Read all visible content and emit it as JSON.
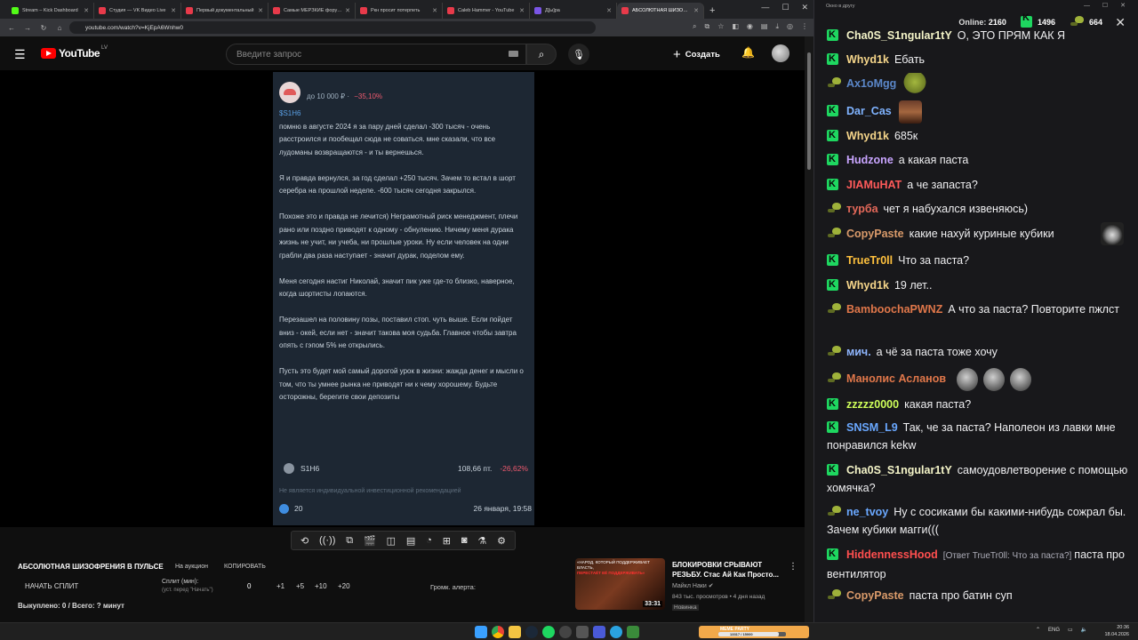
{
  "browser": {
    "tabs": [
      {
        "title": "Stream – Kick Dashboard",
        "color": "#53fc18",
        "active": false
      },
      {
        "title": "Студия — VK Видео Live",
        "color": "#e83a4a",
        "active": false
      },
      {
        "title": "Первый документальный",
        "color": "#e83a4a",
        "active": false
      },
      {
        "title": "Самые МЕРЗКИЕ форумы",
        "color": "#e83a4a",
        "active": false
      },
      {
        "title": "Ркн просит потерпеть",
        "color": "#e83a4a",
        "active": false
      },
      {
        "title": "Caleb Hammer - YouTube",
        "color": "#e83a4a",
        "active": false
      },
      {
        "title": "Д[ы]ра",
        "color": "#7a55e6",
        "active": false
      },
      {
        "title": "АБСОЛЮТНАЯ ШИЗОФРЕНИЯ",
        "color": "#e83a4a",
        "active": true
      }
    ],
    "new_tab": "+",
    "url": "youtube.com/watch?v=KjEpA6Wnhw0"
  },
  "youtube": {
    "logo_text": "YouTube",
    "region": "LV",
    "search_placeholder": "Введите запрос",
    "create_label": "Создать"
  },
  "post": {
    "target": "до 10 000 ₽",
    "change": "−35,10%",
    "author": "$S1H6",
    "paragraphs": [
      "помню в августе 2024 я за пару дней сделал -300 тысяч - очень расстроился и пообещал сюда не соваться. мне сказали, что все лудоманы возвращаются - и ты вернешься.",
      "Я и правда вернулся, за год сделал +250 тысяч. Зачем то встал в шорт серебра на прошлой неделе. -600 тысяч сегодня закрылся.",
      "Похоже это и правда не лечится) Неграмотный риск менеджмент, плечи рано или поздно приводят к одному - обнулению. Ничему меня дурака жизнь не учит, ни учеба, ни прошлые уроки. Ну если человек на одни грабли два раза наступает - значит дурак, поделом ему.",
      "Меня сегодня настиг Николай, значит пик уже где-то близко, наверное, когда шортисты лопаются.",
      "Перезашел на половину позы, поставил стоп. чуть выше. Если пойдет вниз - окей, если нет - значит такова моя судьба. Главное чтобы завтра опять с гэпом 5% не открылись.",
      "Пусть это будет мой самый дорогой урок в жизни: жажда денег и мысли о том, что ты умнее рынка не приводят ни к чему хорошему. Будьте осторожны, берегите свои депозиты"
    ],
    "ticker": "S1H6",
    "price": "108,66 пт.",
    "price_change": "-26,62%",
    "disclaimer": "Не является индивидуальной инвестиционной рекомендацией",
    "likes": "20",
    "date": "26 января, 19:58"
  },
  "panel": {
    "title": "АБСОЛЮТНАЯ ШИЗОФРЕНИЯ В ПУЛЬСЕ",
    "auction": "На аукцион",
    "copy": "КОПИРОВАТЬ",
    "start_split": "НАЧАТЬ СПЛИТ",
    "split_min": "Сплит (мин):",
    "split_hint": "(уст. перед \"Начать\")",
    "split_value": "0",
    "inc": [
      "+1",
      "+5",
      "+10",
      "+20"
    ],
    "alert_label": "Громк. алерта:",
    "bought": "Выкуплено: 0 / Всего: ? минут"
  },
  "recommended": {
    "thumb_text_1": "«НАРОД, КОТОРЫЙ ПОДДЕРЖИВАЕТ ВЛАСТЬ,",
    "thumb_text_2": "ПЕРЕСТАЁТ ЕЁ ПОДДЕРЖИВАТЬ»",
    "duration": "33:31",
    "title": "БЛОКИРОВКИ СРЫВАЮТ РЕЗЬБУ. Стас Ай Как Просто...",
    "channel": "Майкл Наки ✔",
    "meta": "843 тыс. просмотров • 4 дня назад",
    "badge": "Новинка"
  },
  "chat": {
    "window_title": "Окно в другу",
    "online_label": "Online:",
    "online": "2160",
    "kick_count": "1496",
    "tw_count": "664",
    "messages": [
      {
        "badge": "k",
        "user": "Cha0S_S1ngular1tY",
        "color": "#f4f4c8",
        "text": "О, ЭТО ПРЯМ КАК Я",
        "emotes": [],
        "reply": ""
      },
      {
        "badge": "k",
        "user": "Whyd1k",
        "color": "#f5d58a",
        "text": "Ебать",
        "emotes": [],
        "reply": ""
      },
      {
        "badge": "t",
        "user": "Ax1oMgg",
        "color": "#5b87c9",
        "text": "",
        "emotes": [
          "frog"
        ],
        "reply": ""
      },
      {
        "badge": "k",
        "user": "Dar_Cas",
        "color": "#7fb3ff",
        "text": "",
        "emotes": [
          "face"
        ],
        "reply": ""
      },
      {
        "badge": "k",
        "user": "Whyd1k",
        "color": "#f5d58a",
        "text": "685к",
        "emotes": [],
        "reply": ""
      },
      {
        "badge": "",
        "user": "Hudzone",
        "color": "#c9a5ff",
        "text": "а какая паста",
        "emotes": [],
        "reply": ""
      },
      {
        "badge": "k",
        "user": "JIAMuHAT",
        "color": "#ff5a5a",
        "text": "а че запаста?",
        "emotes": [],
        "reply": ""
      },
      {
        "badge": "t",
        "user": "турба",
        "color": "#e6695a",
        "text": "чет я набухался извеняюсь)",
        "emotes": [],
        "reply": ""
      },
      {
        "badge": "t",
        "user": "CopyPaste",
        "color": "#d99a6a",
        "text": "какие нахуй куриные кубики",
        "emotes": [
          "cat"
        ],
        "reply": ""
      },
      {
        "badge": "k",
        "user": "TrueTr0ll",
        "color": "#ffc13d",
        "text": "Что за паста?",
        "emotes": [],
        "reply": ""
      },
      {
        "badge": "k",
        "user": "Whyd1k",
        "color": "#f5d58a",
        "text": "19 лет..",
        "emotes": [],
        "reply": ""
      },
      {
        "badge": "t",
        "user": "BamboochaPWNZ",
        "color": "#e0774a",
        "text": "А что за паста? Повторите пжлст",
        "emotes": [],
        "reply": ""
      },
      {
        "badge": "t",
        "user": "мич.",
        "color": "#8fb6ff",
        "text": "а чё за паста тоже хочу",
        "emotes": [],
        "reply": ""
      },
      {
        "badge": "t",
        "user": "Манолис Асланов",
        "color": "#e0774a",
        "text": "",
        "emotes": [
          "head",
          "head",
          "head"
        ],
        "reply": ""
      },
      {
        "badge": "k",
        "user": "zzzzz0000",
        "color": "#cfff5a",
        "text": "какая паста?",
        "emotes": [],
        "reply": ""
      },
      {
        "badge": "k",
        "user": "SNSM_L9",
        "color": "#6aa8ff",
        "text": "Так, че за паста? Наполеон из лавки мне понравился kekw",
        "emotes": [],
        "reply": ""
      },
      {
        "badge": "k",
        "user": "Cha0S_S1ngular1tY",
        "color": "#f4f4c8",
        "text": "самоудовлетворение с помощью хомячка?",
        "emotes": [],
        "reply": ""
      },
      {
        "badge": "t",
        "user": "ne_tvoy",
        "color": "#6aa8ff",
        "text": "Ну с сосиками бы какими-нибудь сожрал бы. Зачем кубики магги(((",
        "emotes": [],
        "reply": ""
      },
      {
        "badge": "k",
        "user": "HiddennessHood",
        "color": "#ff4f4f",
        "text": "паста про вентилятор",
        "emotes": [],
        "reply": "[Ответ TrueTr0ll: Что за паста?]"
      },
      {
        "badge": "t",
        "user": "CopyPaste",
        "color": "#d99a6a",
        "text": "паста про батин суп",
        "emotes": [],
        "reply": ""
      }
    ]
  },
  "taskbar": {
    "meme_label": "MEME PARTY",
    "meme_count": "13317 / 15000",
    "meme_fraction": 0.89,
    "lang": "ENG",
    "time": "20:36",
    "date": "18.04.2026"
  }
}
